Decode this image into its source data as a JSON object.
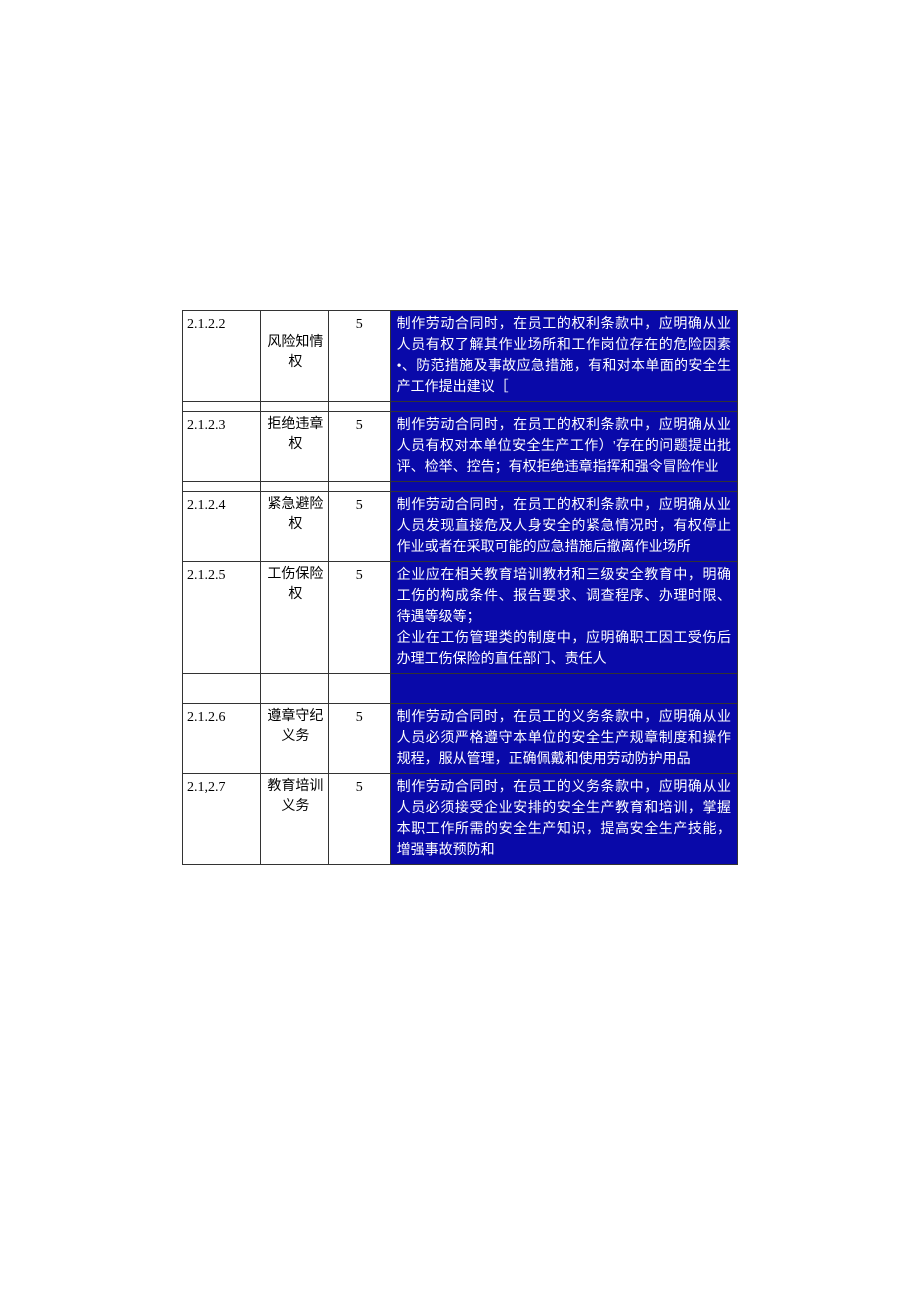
{
  "rows": [
    {
      "id": "2.1.2.2",
      "name": "风险知情权",
      "score": "5",
      "desc": "制作劳动合同时，在员工的权利条款中，应明确从业人员有权了解其作业场所和工作岗位存在的危险因素•、防范措施及事故应急措施，有和对本单面的安全生产工作提出建议［",
      "name_pad": true,
      "spacer_after": true
    },
    {
      "id": "2.1.2.3",
      "name": "拒绝违章权",
      "score": "5",
      "desc": "制作劳动合同时，在员工的权利条款中，应明确从业人员有权对本单位安全生产工作）'存在的问题提出批评、检举、控告；有权拒绝违章指挥和强令冒险作业",
      "spacer_after": true
    },
    {
      "id": "2.1.2.4",
      "name": "紧急避险权",
      "score": "5",
      "desc": "制作劳动合同时，在员工的权利条款中，应明确从业人员发现直接危及人身安全的紧急情况时，有权停止作业或者在采取可能的应急措施后撤离作业场所"
    },
    {
      "id": "2.1.2.5",
      "name": "工伤保险权",
      "score": "5",
      "desc": "企业应在相关教育培训教材和三级安全教育中，明确工伤的构成条件、报告要求、调查程序、办理时限、待遇等级等；\n企业在工伤管理类的制度中，应明确职工因工受伤后办理工伤保险的直任部门、责任人",
      "spacer_after": true,
      "spacer_tall": true
    },
    {
      "id": "2.1.2.6",
      "name": "遵章守纪义务",
      "score": "5",
      "desc": "制作劳动合同时，在员工的义务条款中，应明确从业人员必须严格遵守本单位的安全生产规章制度和操作规程，服从管理，正确佩戴和使用劳动防护用品"
    },
    {
      "id": "2.1,2.7",
      "name": "教育培训义务",
      "score": "5",
      "desc": "制作劳动合同时，在员工的义务条款中，应明确从业人员必须接受企业安排的安全生产教育和培训，掌握本职工作所需的安全生产知识，提高安全生产技能，增强事故预防和"
    }
  ]
}
